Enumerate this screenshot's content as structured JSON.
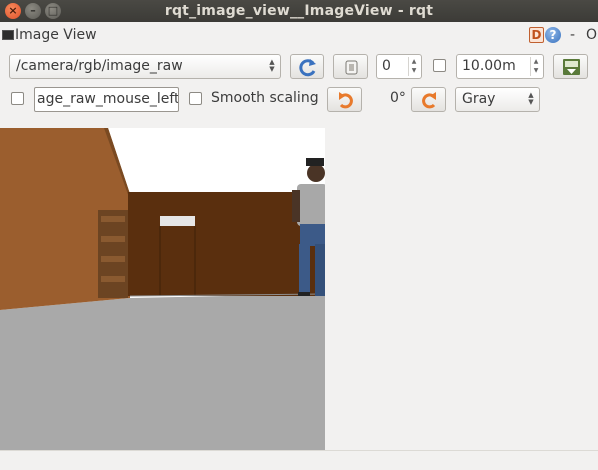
{
  "window": {
    "title": "rqt_image_view__ImageView - rqt"
  },
  "dock": {
    "title": "Image View",
    "d_label": "D",
    "help_label": "?",
    "minimize_label": "-",
    "close_label": "O"
  },
  "toolbar": {
    "topic": "/camera/rgb/image_raw",
    "num_value": "0",
    "max_range": "10.00m",
    "mouse_topic": "age_raw_mouse_left",
    "smooth_label": "Smooth scaling",
    "rotation": "0°",
    "color_scheme": "Gray"
  },
  "icons": {
    "refresh": "refresh-icon",
    "save": "save-icon",
    "rotate_left": "rotate-left-icon",
    "rotate_right": "rotate-right-icon",
    "toggle": "toggle-icon"
  },
  "colors": {
    "accent": "#e2512a",
    "refresh_blue": "#3a72bf",
    "rotate_orange": "#e87a2c"
  }
}
